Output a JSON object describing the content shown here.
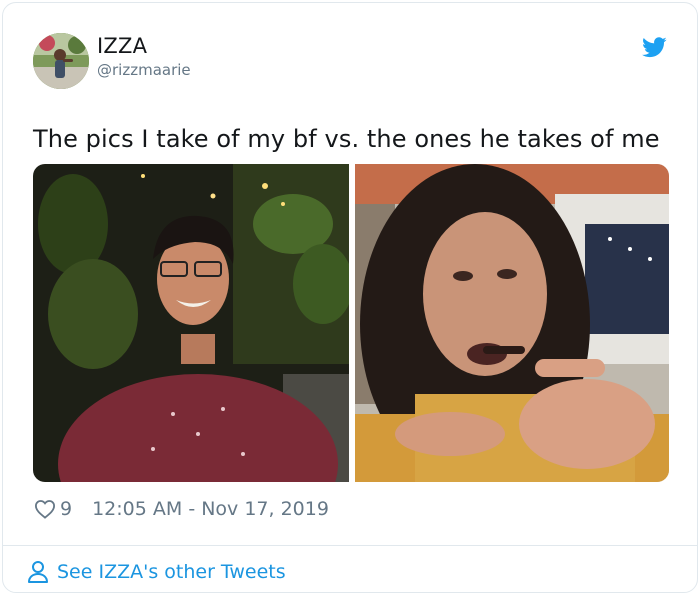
{
  "author": {
    "name": "IZZA",
    "handle": "@rizzmaarie"
  },
  "tweet": {
    "text": "The pics I take of my bf vs. the ones he takes of me",
    "like_count": "9",
    "timestamp": "12:05 AM - Nov 17, 2019"
  },
  "footer": {
    "link_label": "See IZZA's other Tweets"
  },
  "icons": {
    "brand": "twitter-bird-icon",
    "like": "heart-outline-icon",
    "profile": "person-outline-icon"
  },
  "colors": {
    "accent": "#1da1f2",
    "link": "#1b95e0",
    "secondary_text": "#657786",
    "border": "#e1e8ed"
  }
}
